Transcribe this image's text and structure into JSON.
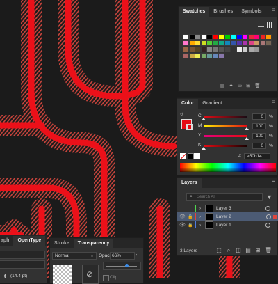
{
  "swatches_panel": {
    "tabs": [
      "Swatches",
      "Brushes",
      "Symbols"
    ],
    "active_tab": "Swatches"
  },
  "color_panel": {
    "tabs": [
      "Color",
      "Gradient"
    ],
    "active_tab": "Color",
    "channels": [
      {
        "label": "C",
        "value": "0",
        "unit": "%"
      },
      {
        "label": "M",
        "value": "100",
        "unit": "%"
      },
      {
        "label": "Y",
        "value": "100",
        "unit": "%"
      },
      {
        "label": "K",
        "value": "0",
        "unit": "%"
      }
    ],
    "hex": "e50b14",
    "fill_color": "#e50b14"
  },
  "layers_panel": {
    "tab": "Layers",
    "search_placeholder": "Search All",
    "layers": [
      {
        "name": "Layer 3",
        "color": "#4fd64f",
        "visible": false,
        "locked": false,
        "selected": false
      },
      {
        "name": "Layer 2",
        "color": "#e0453d",
        "visible": true,
        "locked": true,
        "selected": true
      },
      {
        "name": "Layer 1",
        "color": "#4f7be0",
        "visible": true,
        "locked": true,
        "selected": false
      }
    ],
    "footer_count": "3 Layers"
  },
  "character_panel": {
    "tabs": [
      "aph",
      "OpenType"
    ],
    "size_value": "(14.4 pt)"
  },
  "transparency_panel": {
    "tabs": [
      "Stroke",
      "Transparency"
    ],
    "active_tab": "Transparency",
    "blend_mode": "Normal",
    "opacity_label": "Opacity:",
    "opacity_value": "66%",
    "opacity_fraction": 0.66,
    "clip_label": "Clip"
  },
  "colors": {
    "stroke_red": "#ec1019",
    "hatch": "#c8443c",
    "background": "#1b1b1b",
    "panel": "#323232",
    "accent_blue": "#3b8be6"
  }
}
